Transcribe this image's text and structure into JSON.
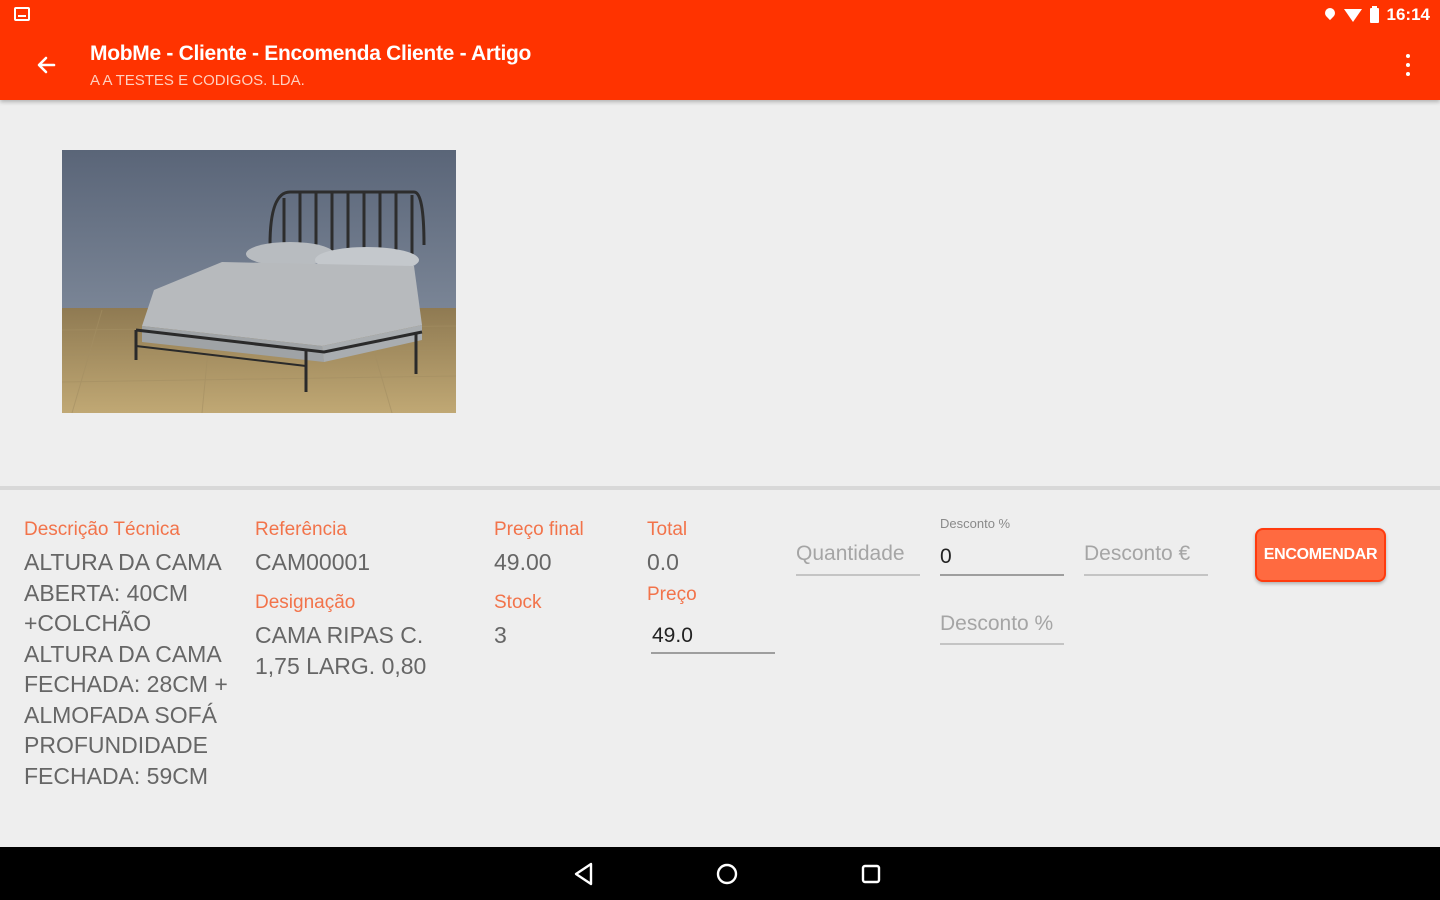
{
  "status_bar": {
    "time": "16:14"
  },
  "app_bar": {
    "title": "MobMe - Cliente - Encomenda Cliente - Artigo",
    "subtitle": "A A TESTES E CODIGOS. LDA."
  },
  "product": {
    "descricao_label": "Descrição Técnica",
    "descricao_lines": [
      "ALTURA DA CAMA",
      "ABERTA: 40CM",
      "+COLCHÃO",
      "ALTURA DA CAMA",
      "FECHADA: 28CM +",
      "ALMOFADA SOFÁ",
      "PROFUNDIDADE",
      "FECHADA: 59CM"
    ],
    "referencia_label": "Referência",
    "referencia": "CAM00001",
    "designacao_label": "Designação",
    "designacao_lines": [
      "CAMA RIPAS C.",
      "1,75 LARG. 0,80"
    ],
    "preco_final_label": "Preço final",
    "preco_final": "49.00",
    "stock_label": "Stock",
    "stock": "3",
    "total_label": "Total",
    "total": "0.0",
    "preco_label": "Preço",
    "preco": "49.0"
  },
  "form": {
    "quantidade_placeholder": "Quantidade",
    "desconto_pct_label": "Desconto %",
    "desconto_pct_value": "0",
    "desconto_eur_placeholder": "Desconto €",
    "desconto_pct2_placeholder": "Desconto %",
    "order_button": "ENCOMENDAR"
  },
  "colors": {
    "app_bar": "#ff3300",
    "accent_label": "#f2734a",
    "button": "#ff6a40",
    "nav_bar": "#000000"
  }
}
